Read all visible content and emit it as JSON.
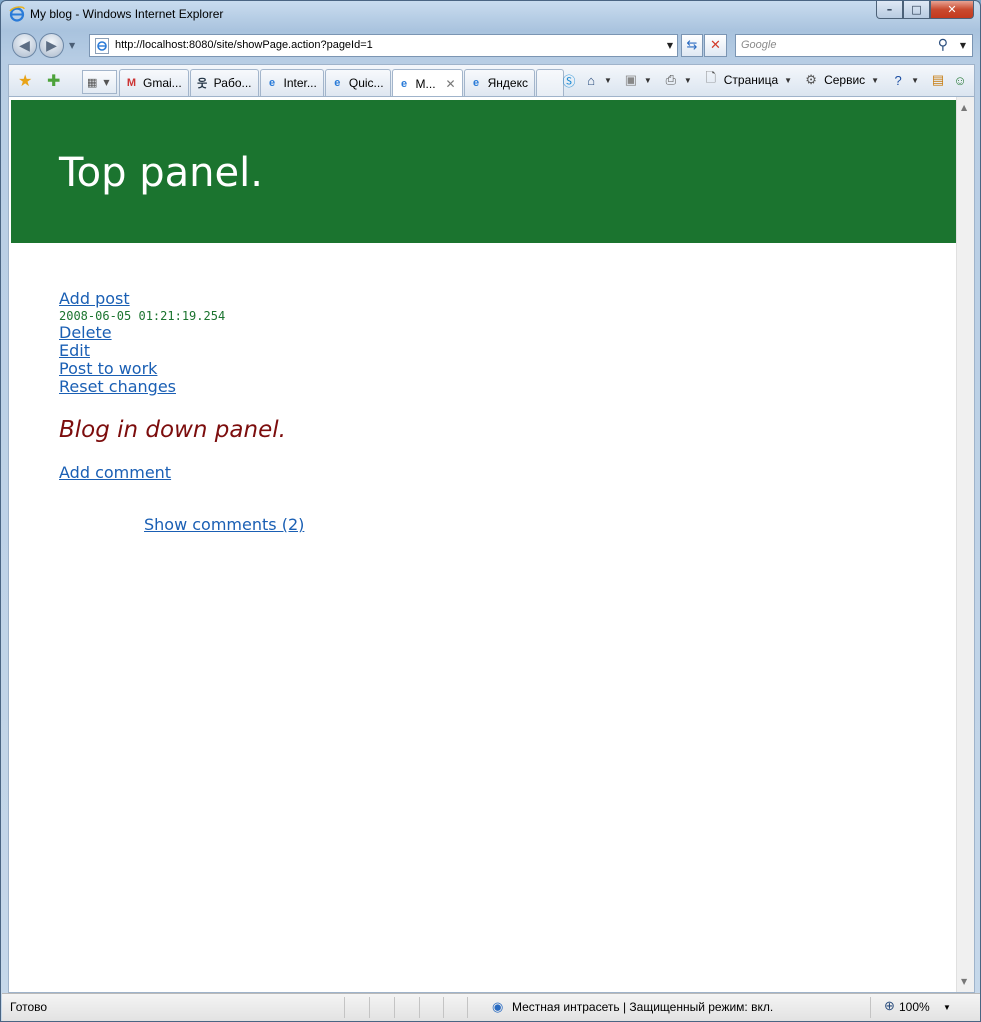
{
  "window": {
    "title": "My blog - Windows Internet Explorer",
    "minimize": "–",
    "maximize": "□",
    "close": "✕"
  },
  "address": {
    "url": "http://localhost:8080/site/showPage.action?pageId=1",
    "search_placeholder": "Google"
  },
  "tabs": [
    {
      "label": "Gmai...",
      "icon": "gmail-icon",
      "active": false
    },
    {
      "label": "Рабо...",
      "icon": "person-icon",
      "active": false
    },
    {
      "label": "Inter...",
      "icon": "ie-page-icon",
      "active": false
    },
    {
      "label": "Quic...",
      "icon": "ie-icon",
      "active": false
    },
    {
      "label": "M...",
      "icon": "ie-icon",
      "active": true
    },
    {
      "label": "Яндекс",
      "icon": "ie-page-icon",
      "active": false
    }
  ],
  "commands": {
    "page_label": "Страница",
    "tools_label": "Сервис"
  },
  "page": {
    "top_panel_title": "Top panel.",
    "add_post": "Add post",
    "timestamp": "2008-06-05 01:21:19.254",
    "delete": "Delete",
    "edit": "Edit",
    "post_to_work": "Post to work",
    "reset_changes": "Reset changes",
    "post_title": "Blog in down panel.",
    "add_comment": "Add comment",
    "show_comments": "Show comments (2)"
  },
  "status": {
    "text": "Готово",
    "zone": "Местная интрасеть | Защищенный режим: вкл.",
    "zoom": "100%"
  },
  "colors": {
    "top_panel_bg": "#1b742f",
    "link": "#1a5fb4",
    "timestamp": "#1b742f",
    "post_title": "#7c0d0d"
  }
}
